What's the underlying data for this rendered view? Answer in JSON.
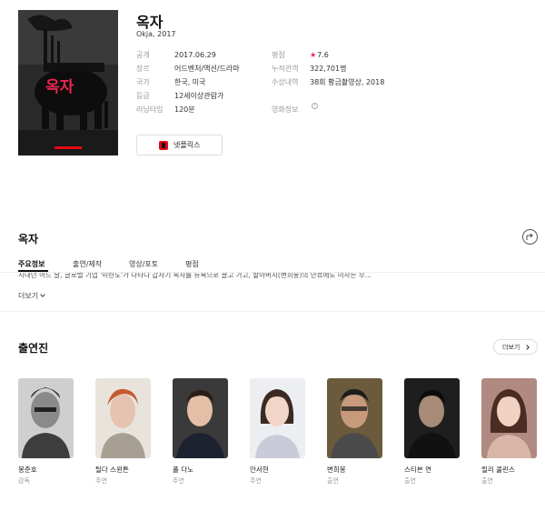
{
  "movie": {
    "title": "옥자",
    "subtitle": "Okja, 2017",
    "poster_title": "옥자",
    "info_left": [
      {
        "key": "공개",
        "value": "2017.06.29"
      },
      {
        "key": "장르",
        "value": "어드벤처/액션/드라마"
      },
      {
        "key": "국가",
        "value": "한국, 미국"
      },
      {
        "key": "등급",
        "value": "12세이상관람가"
      },
      {
        "key": "러닝타임",
        "value": "120분"
      }
    ],
    "info_right": {
      "rating_label": "평점",
      "rating_value": "7.6",
      "audience_label": "누적관객",
      "audience_value": "322,701명",
      "award_label": "수상내역",
      "award_value": "38회 황금촬영상, 2018",
      "video_label": "영화정보"
    },
    "ott_label": "넷플릭스"
  },
  "section": {
    "title": "옥자",
    "tabs": [
      "주요정보",
      "출연/제작",
      "영상/포토",
      "평점"
    ],
    "active_tab": "주요정보",
    "synopsis": "시대던 어느 날, 글로벌 기업 '미란도'가 나타나 갑자기 옥자를 뉴욕으로 끌고 가고, 할아버지(변희봉)의 만류에도 미자는 무...",
    "more_label": "더보기"
  },
  "cast": {
    "title": "출연진",
    "more_label": "더보기",
    "members": [
      {
        "name": "봉준호",
        "role": "감독"
      },
      {
        "name": "틸다 스윈튼",
        "role": "주연"
      },
      {
        "name": "폴 다노",
        "role": "주연"
      },
      {
        "name": "안서현",
        "role": "주연"
      },
      {
        "name": "변희봉",
        "role": "출연"
      },
      {
        "name": "스티븐 연",
        "role": "출연"
      },
      {
        "name": "릴리 콜린스",
        "role": "출연"
      }
    ]
  },
  "colors": {
    "accent_star": "#e8264e",
    "link": "#2a6bc4",
    "netflix": "#e50914"
  }
}
